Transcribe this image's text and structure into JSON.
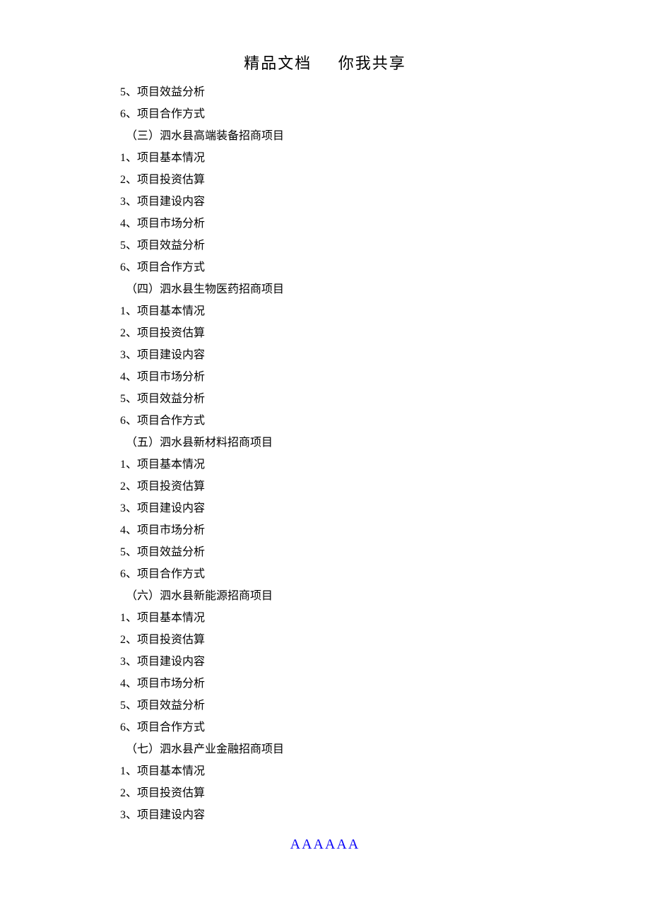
{
  "header": {
    "part1": "精品文档",
    "part2": "你我共享"
  },
  "lines": [
    {
      "text": "5、项目效益分析",
      "indent": false
    },
    {
      "text": "6、项目合作方式",
      "indent": false
    },
    {
      "text": "（三）泗水县高端装备招商项目",
      "indent": true
    },
    {
      "text": "1、项目基本情况",
      "indent": false
    },
    {
      "text": "2、项目投资估算",
      "indent": false
    },
    {
      "text": "3、项目建设内容",
      "indent": false
    },
    {
      "text": "4、项目市场分析",
      "indent": false
    },
    {
      "text": "5、项目效益分析",
      "indent": false
    },
    {
      "text": "6、项目合作方式",
      "indent": false
    },
    {
      "text": "（四）泗水县生物医药招商项目",
      "indent": true
    },
    {
      "text": "1、项目基本情况",
      "indent": false
    },
    {
      "text": "2、项目投资估算",
      "indent": false
    },
    {
      "text": "3、项目建设内容",
      "indent": false
    },
    {
      "text": "4、项目市场分析",
      "indent": false
    },
    {
      "text": "5、项目效益分析",
      "indent": false
    },
    {
      "text": "6、项目合作方式",
      "indent": false
    },
    {
      "text": "（五）泗水县新材料招商项目",
      "indent": true
    },
    {
      "text": "1、项目基本情况",
      "indent": false
    },
    {
      "text": "2、项目投资估算",
      "indent": false
    },
    {
      "text": "3、项目建设内容",
      "indent": false
    },
    {
      "text": "4、项目市场分析",
      "indent": false
    },
    {
      "text": "5、项目效益分析",
      "indent": false
    },
    {
      "text": "6、项目合作方式",
      "indent": false
    },
    {
      "text": "（六）泗水县新能源招商项目",
      "indent": true
    },
    {
      "text": "1、项目基本情况",
      "indent": false
    },
    {
      "text": "2、项目投资估算",
      "indent": false
    },
    {
      "text": "3、项目建设内容",
      "indent": false
    },
    {
      "text": "4、项目市场分析",
      "indent": false
    },
    {
      "text": "5、项目效益分析",
      "indent": false
    },
    {
      "text": "6、项目合作方式",
      "indent": false
    },
    {
      "text": "（七）泗水县产业金融招商项目",
      "indent": true
    },
    {
      "text": "1、项目基本情况",
      "indent": false
    },
    {
      "text": "2、项目投资估算",
      "indent": false
    },
    {
      "text": "3、项目建设内容",
      "indent": false
    }
  ],
  "footer": "AAAAAA"
}
